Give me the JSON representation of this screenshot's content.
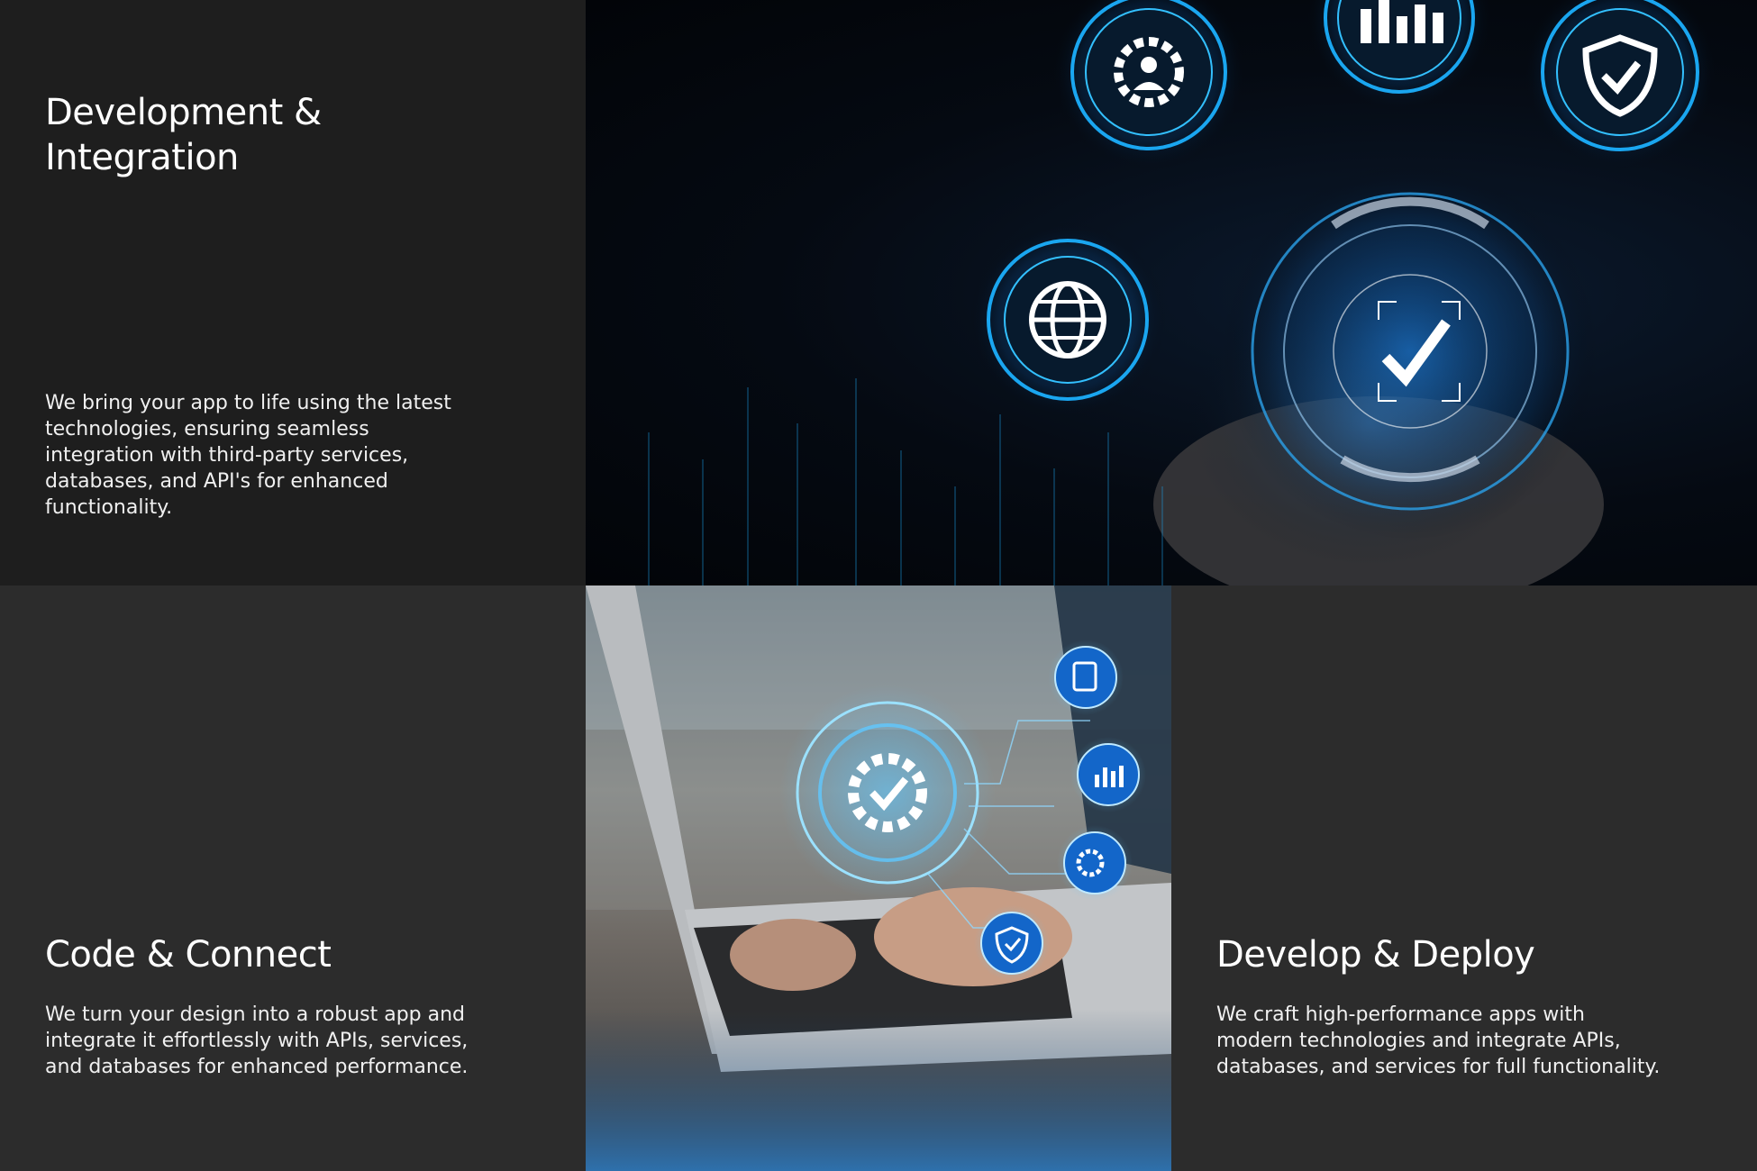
{
  "sections": [
    {
      "title": "Development & Integration",
      "description": "We bring your app to life using the latest technologies, ensuring seamless integration with third-party services, databases, and API's for enhanced functionality."
    },
    {
      "title": "Code & Connect",
      "description": "We turn your design into a robust app and integrate it effortlessly with APIs, services, and databases for enhanced performance."
    },
    {
      "title": "Develop & Deploy",
      "description": "We craft high-performance apps with modern technologies and integrate APIs, databases, and services for full functionality."
    }
  ],
  "images": {
    "top": {
      "icons": [
        "gear-person-icon",
        "bar-chart-icon",
        "shield-check-icon",
        "globe-icon",
        "checkmark-icon"
      ]
    },
    "middle": {
      "icons": [
        "gear-check-icon",
        "clipboard-icon",
        "bar-chart-icon",
        "gear-circuit-icon",
        "shield-check-icon"
      ]
    }
  },
  "colors": {
    "accent": "#2fb6ff",
    "panel_dark": "#1e1e1e",
    "panel_mid": "#2c2c2c"
  }
}
